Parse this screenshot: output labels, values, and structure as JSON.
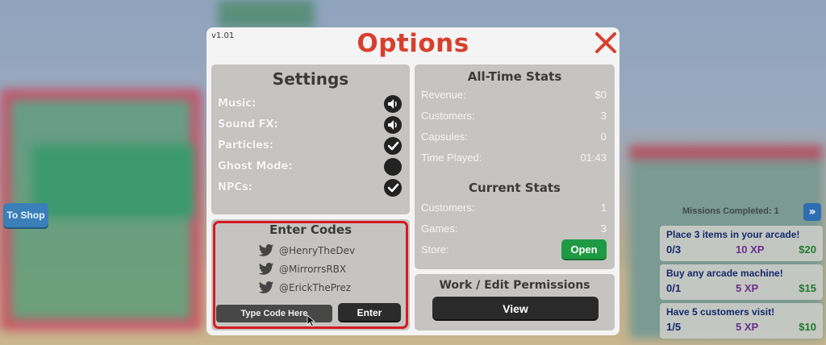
{
  "background": {
    "to_shop_label": "To Shop"
  },
  "missions": {
    "completed_label": "Missions Completed: 1",
    "items": [
      {
        "title": "Place 3 items in your arcade!",
        "progress": "0/3",
        "xp": "10 XP",
        "reward": "$20"
      },
      {
        "title": "Buy any arcade machine!",
        "progress": "0/1",
        "xp": "5 XP",
        "reward": "$15"
      },
      {
        "title": "Have 5 customers visit!",
        "progress": "1/5",
        "xp": "5 XP",
        "reward": "$10"
      }
    ]
  },
  "dialog": {
    "version": "v1.01",
    "title": "Options",
    "colors": {
      "title": "#d8402e",
      "close": "#d8402e",
      "highlight": "#d61a22",
      "open_button": "#1e9a43"
    }
  },
  "settings": {
    "title": "Settings",
    "rows": [
      {
        "label": "Music:",
        "icon": "speaker-icon"
      },
      {
        "label": "Sound FX:",
        "icon": "speaker-icon"
      },
      {
        "label": "Particles:",
        "icon": "checkmark-icon"
      },
      {
        "label": "Ghost Mode:",
        "icon": "empty-toggle-icon"
      },
      {
        "label": "NPCs:",
        "icon": "checkmark-icon"
      }
    ]
  },
  "codes": {
    "title": "Enter Codes",
    "handles": [
      "@HenryTheDev",
      "@MirrorrsRBX",
      "@ErickThePrez"
    ],
    "input_placeholder": "Type Code Here",
    "enter_label": "Enter"
  },
  "all_time_stats": {
    "title": "All-Time Stats",
    "rows": [
      {
        "label": "Revenue:",
        "value": "$0"
      },
      {
        "label": "Customers:",
        "value": "3"
      },
      {
        "label": "Capsules:",
        "value": "0"
      },
      {
        "label": "Time Played:",
        "value": "01:43"
      }
    ]
  },
  "current_stats": {
    "title": "Current Stats",
    "rows": [
      {
        "label": "Customers:",
        "value": "1"
      },
      {
        "label": "Games:",
        "value": "3"
      }
    ],
    "store_label": "Store:",
    "store_button": "Open"
  },
  "permissions": {
    "title": "Work / Edit Permissions",
    "view_label": "View"
  }
}
